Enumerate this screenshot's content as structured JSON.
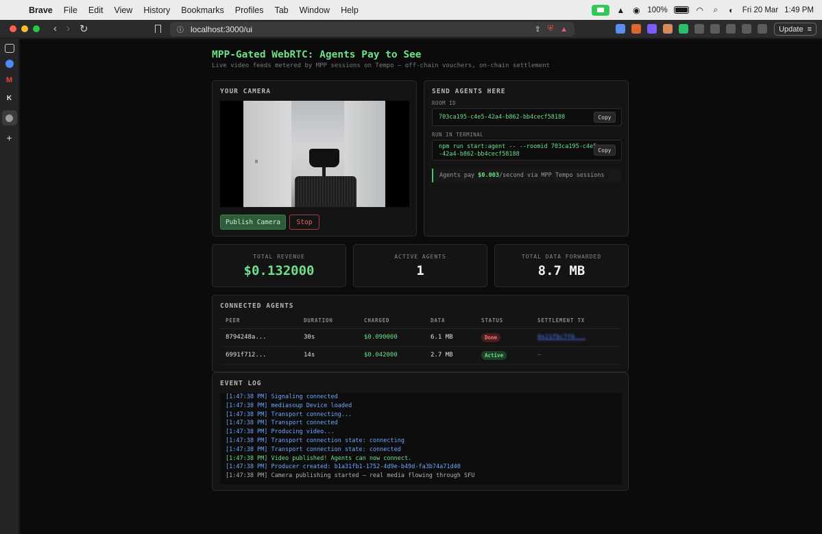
{
  "menubar": {
    "app": "Brave",
    "items": [
      "File",
      "Edit",
      "View",
      "History",
      "Bookmarks",
      "Profiles",
      "Tab",
      "Window",
      "Help"
    ],
    "battery": "100%",
    "date": "Fri 20 Mar",
    "time": "1:49 PM"
  },
  "browser": {
    "url": "localhost:3000/ui",
    "update_label": "Update",
    "traffic_colors": [
      "#ff5f57",
      "#febc2e",
      "#28c840"
    ]
  },
  "page": {
    "title": "MPP-Gated WebRTC: Agents Pay to See",
    "subtitle": "Live video feeds metered by MPP sessions on Tempo — off-chain vouchers, on-chain settlement",
    "camera": {
      "title": "YOUR CAMERA",
      "publish_label": "Publish Camera",
      "stop_label": "Stop"
    },
    "send": {
      "title": "SEND AGENTS HERE",
      "room_label": "ROOM ID",
      "room_id": "703ca195-c4e5-42a4-b862-bb4cecf58188",
      "terminal_label": "RUN IN TERMINAL",
      "terminal_line1": "npm run start:agent -- --roomid 703ca195-c4e5",
      "terminal_line2": "-42a4-b862-bb4cecf58188",
      "copy_label": "Copy",
      "note_prefix": "Agents pay ",
      "note_price": "$0.003",
      "note_suffix": "/second via MPP Tempo sessions"
    },
    "stats": {
      "revenue_label": "TOTAL REVENUE",
      "revenue_value": "$0.132000",
      "agents_label": "ACTIVE AGENTS",
      "agents_value": "1",
      "data_label": "TOTAL DATA FORWARDED",
      "data_value": "8.7 MB"
    },
    "agents": {
      "title": "CONNECTED AGENTS",
      "columns": [
        "PEER",
        "DURATION",
        "CHARGED",
        "DATA",
        "STATUS",
        "SETTLEMENT TX"
      ],
      "rows": [
        {
          "peer": "8794248a...",
          "duration": "30s",
          "charged": "$0.090000",
          "data": "6.1 MB",
          "status": "Done",
          "tx": "0x21fbc7f0..."
        },
        {
          "peer": "6991f712...",
          "duration": "14s",
          "charged": "$0.042000",
          "data": "2.7 MB",
          "status": "Active",
          "tx": "—"
        }
      ]
    },
    "log": {
      "title": "EVENT LOG",
      "lines": [
        {
          "text": "[1:47:38 PM] Signaling connected",
          "kind": "info"
        },
        {
          "text": "[1:47:38 PM] mediasoup Device loaded",
          "kind": "info"
        },
        {
          "text": "[1:47:38 PM] Transport connecting...",
          "kind": "info"
        },
        {
          "text": "[1:47:38 PM] Transport connected",
          "kind": "info"
        },
        {
          "text": "[1:47:38 PM] Producing video...",
          "kind": "info"
        },
        {
          "text": "[1:47:38 PM] Transport connection state: connecting",
          "kind": "info"
        },
        {
          "text": "[1:47:38 PM] Transport connection state: connected",
          "kind": "info"
        },
        {
          "text": "[1:47:38 PM] Video published! Agents can now connect.",
          "kind": "ok"
        },
        {
          "text": "[1:47:38 PM] Producer created: b1a31fb1-1752-4d9e-b49d-fa3b74a71d40",
          "kind": "info"
        },
        {
          "text": "[1:47:38 PM] Camera publishing started — real media flowing through SFU",
          "kind": "plain"
        }
      ]
    }
  },
  "colors": {
    "accent_green": "#6ee08a",
    "danger_red": "#ef6a6a",
    "link_blue": "#4a7dff",
    "background": "#0b0b0b"
  }
}
